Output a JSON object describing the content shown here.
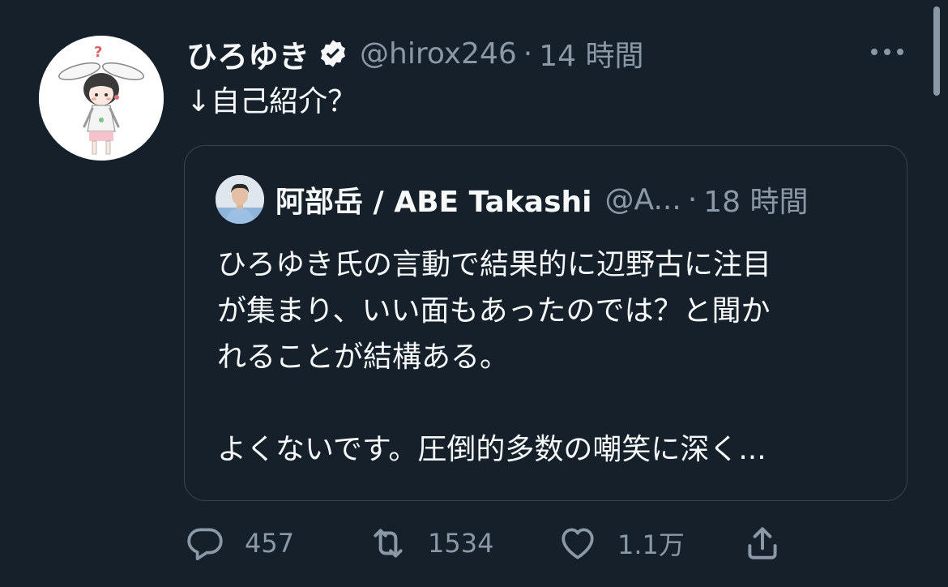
{
  "author": {
    "display_name": "ひろゆき",
    "handle": "@hirox246",
    "separator": "·",
    "time": "14 時間",
    "verified_icon": "verified-badge-icon"
  },
  "tweet_text": "↓自己紹介？",
  "quoted_tweet": {
    "display_name": "阿部岳 / ABE Takashi",
    "handle": "@A...",
    "separator": "·",
    "time": "18 時間",
    "lines": [
      "ひろゆき氏の言動で結果的に辺野古に注目",
      "が集まり、いい面もあったのでは？と聞か",
      "れることが結構ある。",
      "",
      "よくないです。圧倒的多数の嘲笑に深く..."
    ]
  },
  "actions": {
    "reply_count": "457",
    "retweet_count": "1534",
    "like_count": "1.1万",
    "share_icon": "share-icon"
  },
  "colors": {
    "background": "#15202b",
    "text_primary": "#f7f9f9",
    "text_secondary": "#8b98a5",
    "border": "#38444d"
  }
}
